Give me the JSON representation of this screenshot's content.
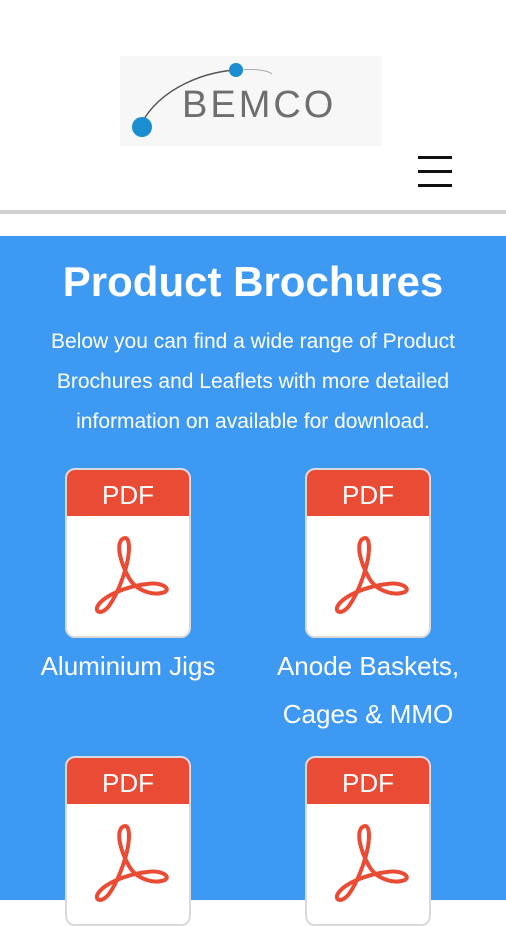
{
  "header": {
    "logo_text": "BEMCO",
    "menu_icon": "hamburger-menu-icon"
  },
  "main": {
    "title": "Product Brochures",
    "intro": "Below you can find a wide range of Product Brochures and Leaflets with more detailed information on available for download."
  },
  "brochures": [
    {
      "badge": "PDF",
      "label": "Aluminium Jigs"
    },
    {
      "badge": "PDF",
      "label": "Anode Baskets, Cages & MMO"
    },
    {
      "badge": "PDF",
      "label": ""
    },
    {
      "badge": "PDF",
      "label": ""
    }
  ],
  "colors": {
    "accent_blue": "#3d99f2",
    "pdf_red": "#e94b35",
    "logo_blue": "#1a8ed1"
  }
}
